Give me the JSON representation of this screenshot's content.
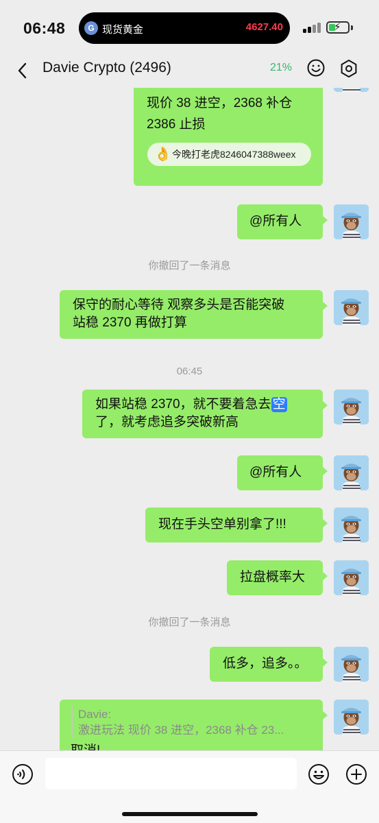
{
  "status_bar": {
    "time": "06:48",
    "island_label": "现货黄金",
    "island_price": "4627.40"
  },
  "header": {
    "title": "Davie Crypto (2496)",
    "battery_percent": "21%"
  },
  "messages": {
    "m1_line1": "现价 38 进空，2368 补仓",
    "m1_line2": "2386 止损",
    "m1_chip": "今晚打老虎8246047388weex",
    "m2": "@所有人",
    "sys1": "你撤回了一条消息",
    "m3_line1": "保守的耐心等待 观察多头是否能突破",
    "m3_line2": "站稳 2370 再做打算",
    "time_divider": "06:45",
    "m4_line1a": "如果站稳 2370，就不要着急去",
    "m4_kong": "空",
    "m4_line2": "了，就考虑追多突破新高",
    "m5": "@所有人",
    "m6": "现在手头空单别拿了!!!",
    "m7": "拉盘概率大",
    "sys2": "你撤回了一条消息",
    "m8": "低多，追多。。",
    "m9_quote_name": "Davie:",
    "m9_quote_text": "激进玩法  现价 38 进空，2368 补仓  23...",
    "m9_text": "取消!"
  },
  "colors": {
    "bubble_green": "#95ec69",
    "chat_background": "#ededed",
    "price_red": "#ff3b4d",
    "battery_green": "#34c759"
  },
  "icons": [
    "back-icon",
    "emoji-icon",
    "settings-icon",
    "voice-icon",
    "plus-icon",
    "ok-hand-icon",
    "ape-avatar"
  ]
}
